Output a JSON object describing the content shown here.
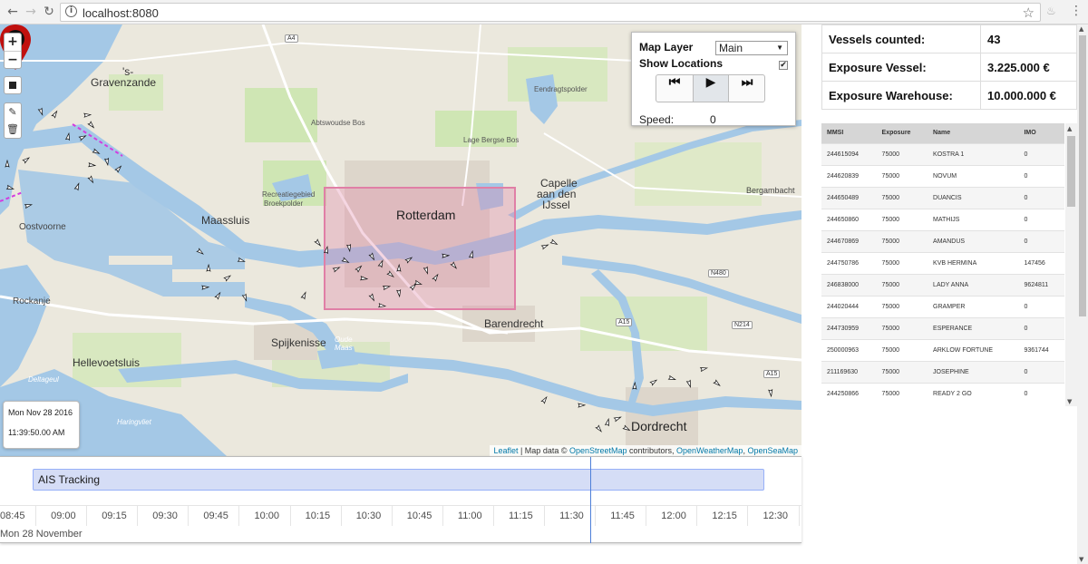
{
  "browser": {
    "back_icon": "←",
    "forward_icon": "→",
    "reload_icon": "↻",
    "info_icon": "i",
    "url": "localhost:8080",
    "star_icon": "☆",
    "extension_icon": "♨",
    "menu_icon": "⋮"
  },
  "map": {
    "zoom_in": "+",
    "zoom_out": "−",
    "edit_icon": "✎",
    "delete_icon": "🗑",
    "labels": {
      "gravenzande_1": "'s-",
      "gravenzande_2": "Gravenzande",
      "maassluis": "Maassluis",
      "oostvoorne": "Oostvoorne",
      "rockanje": "Rockanje",
      "hellevoetsluis": "Hellevoetsluis",
      "spijkenisse": "Spijkenisse",
      "rotterdam": "Rotterdam",
      "barendrecht": "Barendrecht",
      "capelle_1": "Capelle",
      "capelle_2": "aan den",
      "capelle_3": "IJssel",
      "bergambacht": "Bergambacht",
      "dordrecht": "Dordrecht",
      "abtswoude": "Abtswoudse Bos",
      "lage_bergse": "Lage Bergse Bos",
      "eendragtspolder": "Eendragtspolder",
      "recreatiegebied_1": "Recreatiegebied",
      "recreatiegebied_2": "Broekpolder",
      "deltageul": "Deltageul",
      "haringvliet": "Haringvliet",
      "oude_maas_1": "Oude",
      "oude_maas_2": "Maas"
    },
    "roads": {
      "a4": "A4",
      "n480": "N480",
      "a15_1": "A15",
      "a15_2": "A15",
      "n214": "N214"
    },
    "layer_panel": {
      "map_layer_label": "Map Layer",
      "map_layer_value": "Main",
      "show_locations_label": "Show Locations",
      "show_locations_checked": "✔",
      "prev_icon": "⏮",
      "play_icon": "▶",
      "next_icon": "⏭",
      "speed_label": "Speed:",
      "speed_value": "0"
    },
    "date_box": {
      "date": "Mon Nov 28 2016",
      "time": "11:39:50.00 AM"
    },
    "attribution": {
      "leaflet": "Leaflet",
      "sep": " | Map data © ",
      "osm": "OpenStreetMap",
      "contributors": " contributors, ",
      "owm": "OpenWeatherMap",
      "comma": ", ",
      "osea": "OpenSeaMap"
    }
  },
  "timeline": {
    "item_label": "AIS Tracking",
    "ticks": [
      "08:45",
      "09:00",
      "09:15",
      "09:30",
      "09:45",
      "10:00",
      "10:15",
      "10:30",
      "10:45",
      "11:00",
      "11:15",
      "11:30",
      "11:45",
      "12:00",
      "12:15",
      "12:30"
    ],
    "major_label": "Mon 28 November"
  },
  "stats": {
    "vessels_label": "Vessels counted:",
    "vessels_value": "43",
    "exposure_vessel_label": "Exposure Vessel:",
    "exposure_vessel_value": "3.225.000 €",
    "exposure_warehouse_label": "Exposure Warehouse:",
    "exposure_warehouse_value": "10.000.000 €"
  },
  "vessels": {
    "headers": [
      "MMSI",
      "Exposure",
      "Name",
      "IMO"
    ],
    "rows": [
      [
        "244615094",
        "75000",
        "KOSTRA 1",
        "0"
      ],
      [
        "244620839",
        "75000",
        "NOVUM",
        "0"
      ],
      [
        "244650489",
        "75000",
        "DUANCIS",
        "0"
      ],
      [
        "244650860",
        "75000",
        "MATHIJS",
        "0"
      ],
      [
        "244670869",
        "75000",
        "AMANDUS",
        "0"
      ],
      [
        "244750786",
        "75000",
        "KVB HERMINA",
        "147456"
      ],
      [
        "246838000",
        "75000",
        "LADY ANNA",
        "9624811"
      ],
      [
        "244020444",
        "75000",
        "GRAMPER",
        "0"
      ],
      [
        "244730959",
        "75000",
        "ESPERANCE",
        "0"
      ],
      [
        "250000963",
        "75000",
        "ARKLOW FORTUNE",
        "9361744"
      ],
      [
        "211169630",
        "75000",
        "JOSEPHINE",
        "0"
      ],
      [
        "244250866",
        "75000",
        "READY 2 GO",
        "0"
      ]
    ]
  },
  "colors": {
    "water": "#a4c8e6",
    "land": "#ebe8dd",
    "green": "#cfe6b4",
    "highlight": "#e07fa6",
    "timeline_item": "#d5ddf6",
    "timeline_cursor": "#4e7fd8",
    "marker": "#c0100e"
  }
}
